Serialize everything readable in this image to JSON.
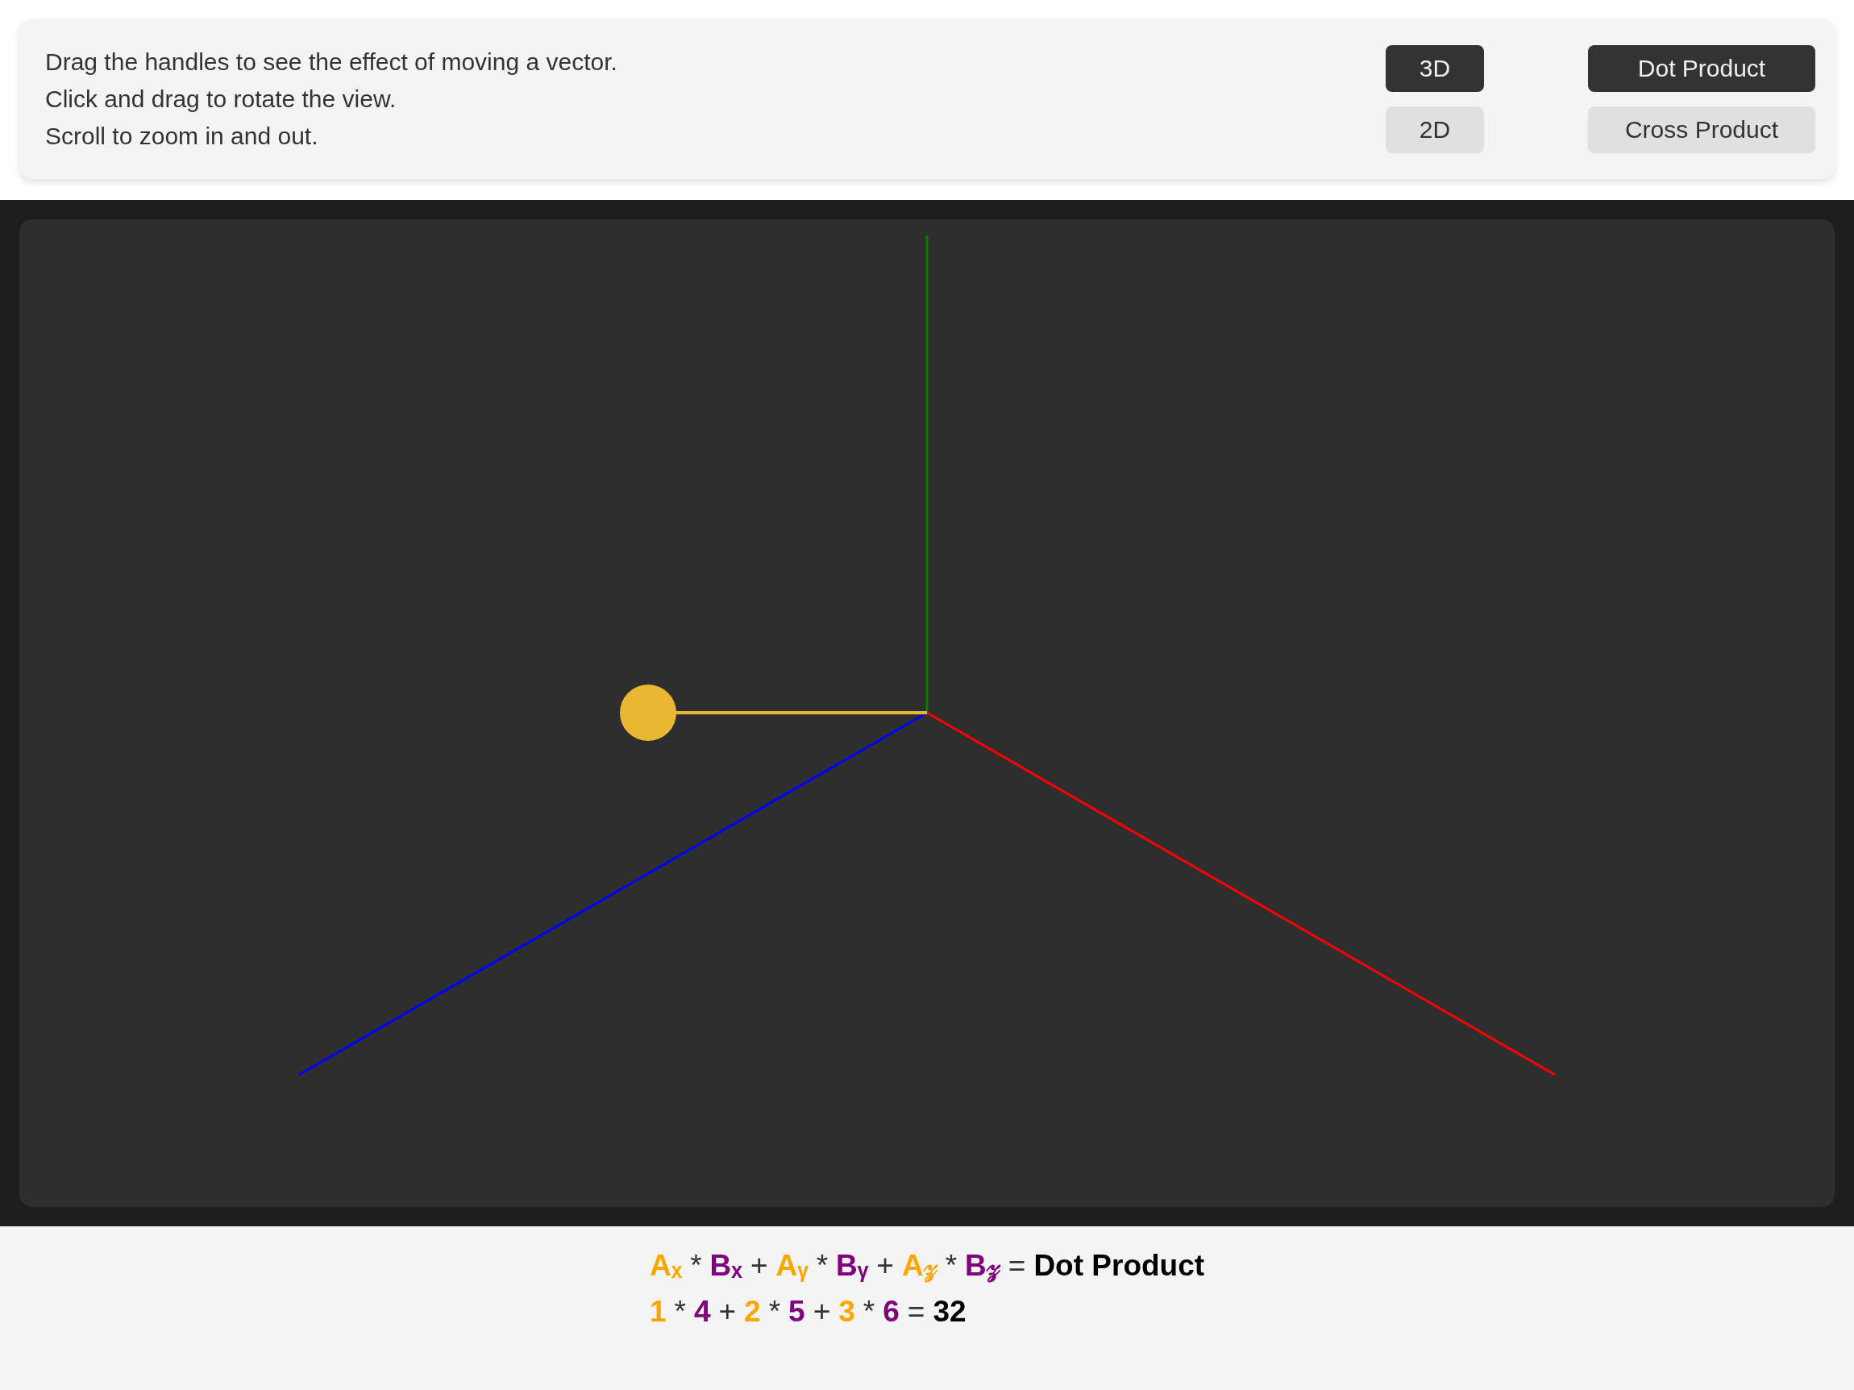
{
  "instructions": [
    "Drag the handles to see the effect of moving a vector.",
    "Click and drag to rotate the view.",
    "Scroll to zoom in and out."
  ],
  "view_buttons": [
    {
      "label": "3D",
      "selected": true
    },
    {
      "label": "2D",
      "selected": false
    }
  ],
  "product_buttons": [
    {
      "label": "Dot Product",
      "selected": true
    },
    {
      "label": "Cross Product",
      "selected": false
    }
  ],
  "formula": {
    "lines": [
      [
        {
          "text": "Aₓ",
          "kind": "vector_a"
        },
        {
          "text": "*",
          "kind": "operator"
        },
        {
          "text": "Bₓ",
          "kind": "vector_b"
        },
        {
          "text": "+",
          "kind": "operator"
        },
        {
          "text": "Aᵧ",
          "kind": "vector_a"
        },
        {
          "text": "*",
          "kind": "operator"
        },
        {
          "text": "Bᵧ",
          "kind": "vector_b"
        },
        {
          "text": "+",
          "kind": "operator"
        },
        {
          "text": "A𝓏",
          "kind": "vector_a"
        },
        {
          "text": "*",
          "kind": "operator"
        },
        {
          "text": "B𝓏",
          "kind": "vector_b"
        },
        {
          "text": "=",
          "kind": "operator"
        },
        {
          "text": "Dot Product",
          "kind": "result"
        }
      ],
      [
        {
          "text": "1",
          "kind": "vector_a"
        },
        {
          "text": "*",
          "kind": "operator"
        },
        {
          "text": "4",
          "kind": "vector_b"
        },
        {
          "text": "+",
          "kind": "operator"
        },
        {
          "text": "2",
          "kind": "vector_a"
        },
        {
          "text": "*",
          "kind": "operator"
        },
        {
          "text": "5",
          "kind": "vector_b"
        },
        {
          "text": "+",
          "kind": "operator"
        },
        {
          "text": "3",
          "kind": "vector_a"
        },
        {
          "text": "*",
          "kind": "operator"
        },
        {
          "text": "6",
          "kind": "vector_b"
        },
        {
          "text": "=",
          "kind": "operator"
        },
        {
          "text": "32",
          "kind": "result"
        }
      ]
    ]
  }
}
